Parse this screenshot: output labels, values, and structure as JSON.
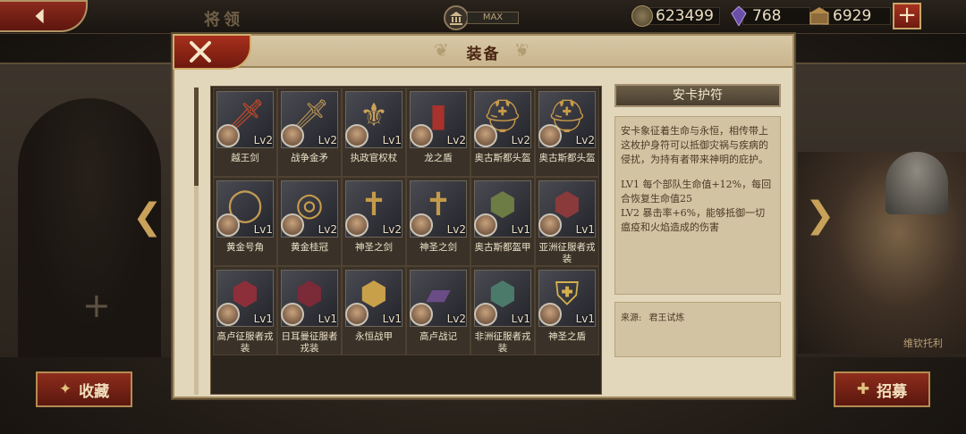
{
  "topbar": {
    "title": "将领",
    "max_label": "MAX",
    "resources": [
      {
        "name": "coin-icon",
        "value": "623499"
      },
      {
        "name": "gem-icon",
        "value": "768"
      },
      {
        "name": "treasure-icon",
        "value": "6929"
      }
    ],
    "plus_label": "+"
  },
  "modal": {
    "title": "装备",
    "items": [
      {
        "name": "越王剑",
        "level": "Lv2",
        "glyph": "🗡",
        "color": "#c24a2a"
      },
      {
        "name": "战争金矛",
        "level": "Lv2",
        "glyph": "🗡",
        "color": "#b59052"
      },
      {
        "name": "执政官权杖",
        "level": "Lv1",
        "glyph": "⚜",
        "color": "#c9a25a"
      },
      {
        "name": "龙之盾",
        "level": "Lv2",
        "glyph": "▮",
        "color": "#a8322c"
      },
      {
        "name": "奥古斯都头盔",
        "level": "Lv2",
        "glyph": "⛑",
        "color": "#c89a48"
      },
      {
        "name": "奥古斯都头盔",
        "level": "Lv2",
        "glyph": "⛑",
        "color": "#c89a48"
      },
      {
        "name": "黄金号角",
        "level": "Lv1",
        "glyph": "◯",
        "color": "#c29a52"
      },
      {
        "name": "黄金桂冠",
        "level": "Lv2",
        "glyph": "◎",
        "color": "#c79c4b"
      },
      {
        "name": "神圣之剑",
        "level": "Lv2",
        "glyph": "✝",
        "color": "#c49a4a"
      },
      {
        "name": "神圣之剑",
        "level": "Lv2",
        "glyph": "✝",
        "color": "#c49a4a"
      },
      {
        "name": "奥古斯都盔甲",
        "level": "Lv1",
        "glyph": "⬢",
        "color": "#6d7b44"
      },
      {
        "name": "亚洲征服者戎装",
        "level": "Lv1",
        "glyph": "⬢",
        "color": "#8a3a3a"
      },
      {
        "name": "高卢征服者戎装",
        "level": "Lv1",
        "glyph": "⬢",
        "color": "#8c2f3a"
      },
      {
        "name": "日耳曼征服者戎装",
        "level": "Lv1",
        "glyph": "⬢",
        "color": "#7b2a38"
      },
      {
        "name": "永恒战甲",
        "level": "Lv1",
        "glyph": "⬢",
        "color": "#c9a04a"
      },
      {
        "name": "高卢战记",
        "level": "Lv2",
        "glyph": "▰",
        "color": "#6a4c86"
      },
      {
        "name": "非洲征服者戎装",
        "level": "Lv1",
        "glyph": "⬢",
        "color": "#4c7a6a"
      },
      {
        "name": "神圣之盾",
        "level": "Lv1",
        "glyph": "⛨",
        "color": "#d4b04c"
      }
    ],
    "detail": {
      "title": "安卡护符",
      "description": "安卡象征着生命与永恒，相传带上这枚护身符可以抵御灾祸与疾病的侵扰，为持有者带来神明的庇护。",
      "lv1": "LV1 每个部队生命值+12%，每回合恢复生命值25",
      "lv2": "LV2 暴击率+6%，能够抵御一切瘟疫和火焰造成的伤害",
      "source_label": "来源:",
      "source_value": "君王试炼"
    }
  },
  "bottom": {
    "collect_label": "收藏",
    "recruit_label": "招募"
  },
  "hero": {
    "name": "维钦托利"
  }
}
